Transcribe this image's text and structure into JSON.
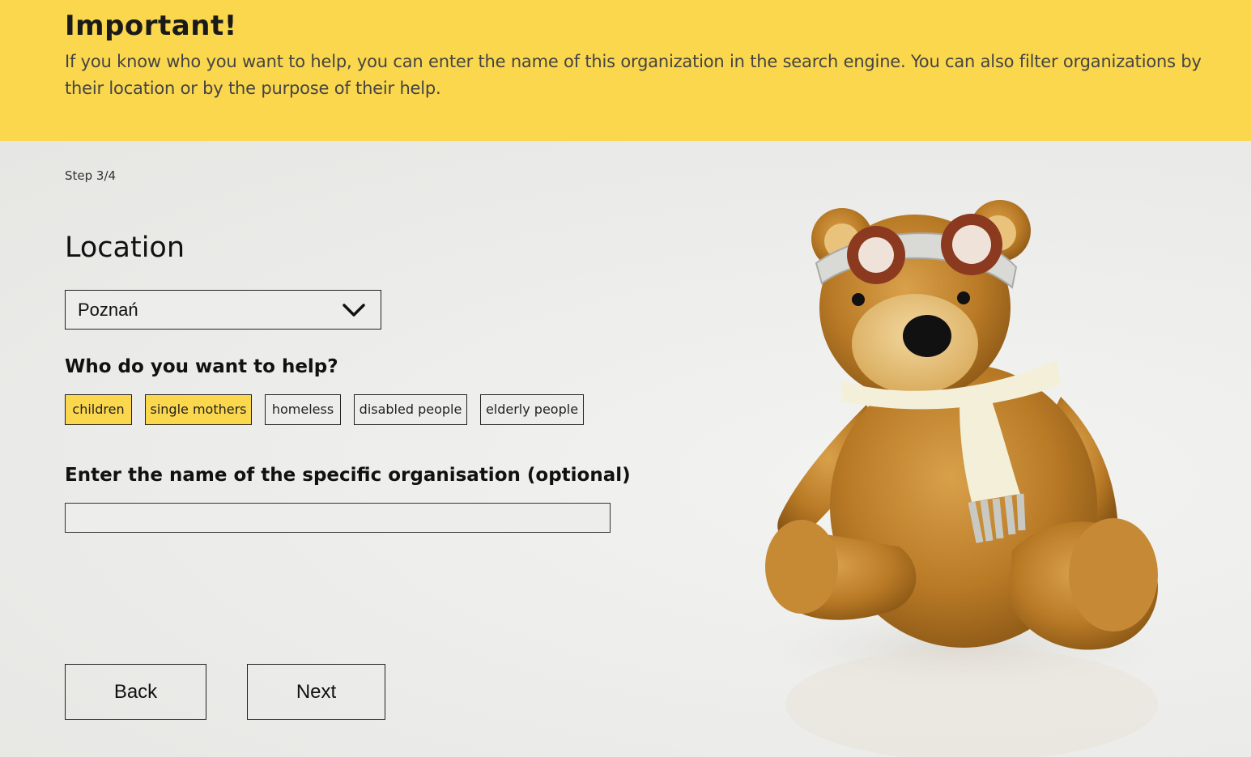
{
  "banner": {
    "title": "Important!",
    "text": "If you know who you want to help, you can enter the name of this organization in the search engine. You can also filter organizations by their location or by the purpose of their help."
  },
  "step": "Step 3/4",
  "location": {
    "title": "Location",
    "selected": "Poznań"
  },
  "help": {
    "title": "Who do you want to help?",
    "chips": [
      {
        "label": "children",
        "selected": true
      },
      {
        "label": "single mothers",
        "selected": true
      },
      {
        "label": "homeless",
        "selected": false
      },
      {
        "label": "disabled people",
        "selected": false
      },
      {
        "label": "elderly people",
        "selected": false
      }
    ]
  },
  "organisation": {
    "title": "Enter the name of the specific organisation (optional)",
    "value": ""
  },
  "buttons": {
    "back": "Back",
    "next": "Next"
  },
  "colors": {
    "accent": "#fbd74e",
    "background": "#ededeb"
  },
  "icons": {
    "select": "chevron-down-icon",
    "illustration": "teddy-bear"
  }
}
